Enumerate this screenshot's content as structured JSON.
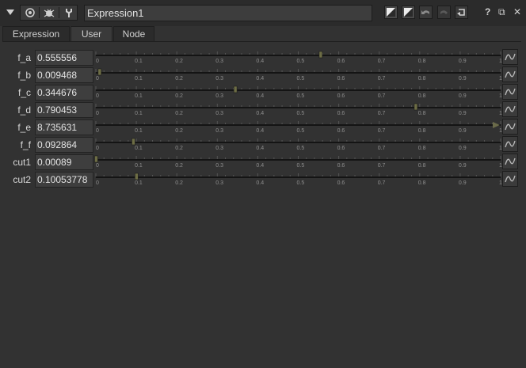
{
  "window": {
    "node_name": "Expression1",
    "help_label": "?",
    "float_label": "⧉",
    "close_label": "✕"
  },
  "tabs": [
    {
      "label": "Expression",
      "active": false
    },
    {
      "label": "User",
      "active": true
    },
    {
      "label": "Node",
      "active": false
    }
  ],
  "slider_ticks": [
    "0",
    "0.1",
    "0.2",
    "0.3",
    "0.4",
    "0.5",
    "0.6",
    "0.7",
    "0.8",
    "0.9",
    "1"
  ],
  "knobs": [
    {
      "label": "f_a",
      "value": "0.555556",
      "num": 0.555556
    },
    {
      "label": "f_b",
      "value": "0.009468",
      "num": 0.009468
    },
    {
      "label": "f_c",
      "value": "0.344676",
      "num": 0.344676
    },
    {
      "label": "f_d",
      "value": "0.790453",
      "num": 0.790453
    },
    {
      "label": "f_e",
      "value": "8.735631",
      "num": 8.735631
    },
    {
      "label": "f_f",
      "value": "0.092864",
      "num": 0.092864
    },
    {
      "label": "cut1",
      "value": "0.00089",
      "num": 0.00089
    },
    {
      "label": "cut2",
      "value": "0.10053778",
      "num": 0.10053778
    }
  ]
}
